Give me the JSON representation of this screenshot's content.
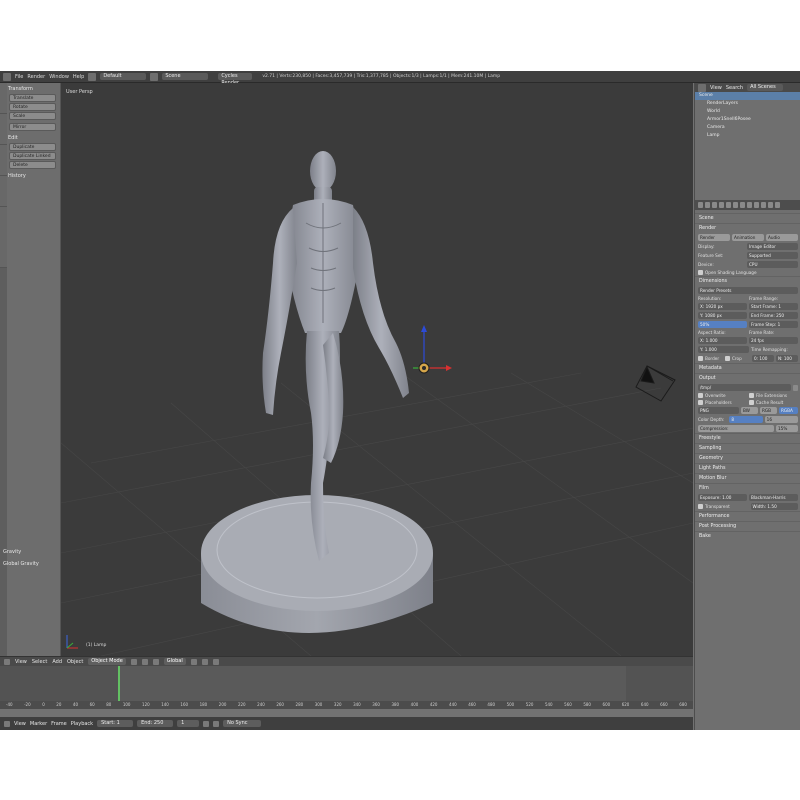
{
  "topbar": {
    "menus": [
      "File",
      "Render",
      "Window",
      "Help"
    ],
    "layout": "Default",
    "scene": "Scene",
    "engine": "Cycles Render",
    "stats": "v2.71 | Verts:230,850 | Faces:3,457,739 | Tris:1,377,785 | Objects:1/3 | Lamps:1/1 | Mem:241.10M | Lamp"
  },
  "shelf": {
    "transform_head": "Transform",
    "transform_buttons": [
      "Translate",
      "Rotate",
      "Scale",
      "Mirror"
    ],
    "edit_head": "Edit",
    "edit_buttons": [
      "Duplicate",
      "Duplicate Linked",
      "Delete"
    ],
    "history_head": "History",
    "gravity_head": "Gravity",
    "gravity_item": "Global Gravity"
  },
  "viewport": {
    "label": "User Persp",
    "object": "(1) Lamp"
  },
  "viewport_header": {
    "menus": [
      "View",
      "Select",
      "Add",
      "Object"
    ],
    "mode": "Object Mode",
    "pivot": "Global"
  },
  "timeline": {
    "ruler": [
      "-40",
      "-20",
      "0",
      "20",
      "40",
      "60",
      "80",
      "100",
      "120",
      "140",
      "160",
      "180",
      "200",
      "220",
      "240",
      "260",
      "280",
      "300",
      "320",
      "340",
      "360",
      "380",
      "400",
      "420",
      "440",
      "460",
      "480",
      "500",
      "520",
      "540",
      "560",
      "580",
      "600",
      "620",
      "640",
      "660",
      "680"
    ],
    "footer_menus": [
      "View",
      "Marker",
      "Frame",
      "Playback"
    ],
    "start": "Start: 1",
    "end": "End: 250",
    "current": "1",
    "sync": "No Sync"
  },
  "outliner": {
    "menus": [
      "View",
      "Search"
    ],
    "filter": "All Scenes",
    "rows": [
      "Scene",
      "RenderLayers",
      "World",
      "Armor1Snell6Posee",
      "Camera",
      "Lamp"
    ]
  },
  "properties": {
    "scene_path": "Scene",
    "render_head": "Render",
    "render_tabs": [
      "Render",
      "Animation",
      "Audio"
    ],
    "display_label": "Display:",
    "display_value": "Image Editor",
    "feature_label": "Feature Set:",
    "feature_value": "Supported",
    "device_label": "Device:",
    "device_value": "CPU",
    "open_shading": "Open Shading Language",
    "dimensions_head": "Dimensions",
    "presets": "Render Presets",
    "resolution_label": "Resolution:",
    "res_x": "X: 1920 px",
    "res_y": "Y: 1080 px",
    "res_pct": "50%",
    "frame_range_label": "Frame Range:",
    "start_frame": "Start Frame: 1",
    "end_frame": "End Frame: 250",
    "frame_step": "Frame Step: 1",
    "aspect_label": "Aspect Ratio:",
    "aspect_x": "X: 1.000",
    "aspect_y": "Y: 1.000",
    "frame_rate_label": "Frame Rate:",
    "frame_rate": "24 fps",
    "time_remap": "Time Remapping:",
    "old": "0: 100",
    "new": "N: 100",
    "border": "Border",
    "crop": "Crop",
    "metadata_head": "Metadata",
    "output_head": "Output",
    "output_path": "/tmp/",
    "overwrite": "Overwrite",
    "file_ext": "File Extensions",
    "placeholders": "Placeholders",
    "cache_result": "Cache Result",
    "format": "PNG",
    "bw": "BW",
    "rgb": "RGB",
    "rgba": "RGBA",
    "color_depth": "Color Depth:",
    "depth8": "8",
    "depth16": "16",
    "compression": "Compression:",
    "compression_val": "15%",
    "freestyle_head": "Freestyle",
    "sampling_head": "Sampling",
    "geometry_head": "Geometry",
    "light_paths_head": "Light Paths",
    "motion_blur_head": "Motion Blur",
    "film_head": "Film",
    "exposure": "Exposure: 1.00",
    "filter": "Blackman-Harris",
    "transparent": "Transparent",
    "width": "Width: 1.50",
    "performance_head": "Performance",
    "post_head": "Post Processing",
    "bake_head": "Bake"
  },
  "colors": {
    "viewport_bg": "#3b3b3b",
    "panel_bg": "#727272",
    "model": "#9da0aa",
    "accent_blue": "#5680c2",
    "timeline_cursor": "#63c163"
  }
}
